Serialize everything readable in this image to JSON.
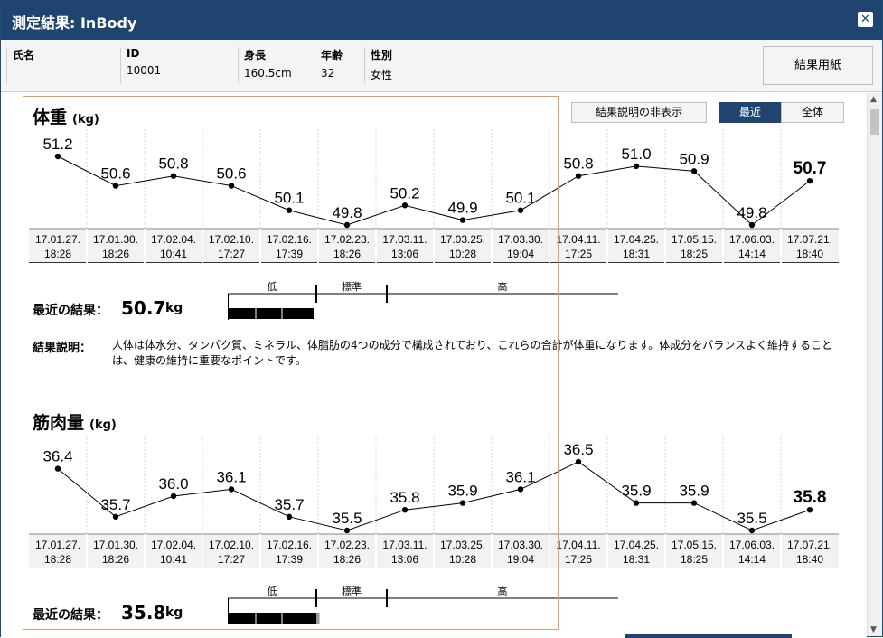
{
  "window": {
    "title": "測定結果: InBody",
    "close_label": "✕"
  },
  "profile": {
    "name": {
      "label": "氏名",
      "value": ""
    },
    "id": {
      "label": "ID",
      "value": "10001"
    },
    "height": {
      "label": "身長",
      "value": "160.5cm"
    },
    "age": {
      "label": "年齢",
      "value": "32"
    },
    "sex": {
      "label": "性別",
      "value": "女性"
    }
  },
  "result_paper_button": "結果用紙",
  "toolbar": {
    "toggle_desc": "結果説明の非表示",
    "range_recent": "最近",
    "range_all": "全体",
    "active_range": "最近"
  },
  "colors": {
    "title_bar": "#1f4470",
    "highlight_border": "#e3a05a",
    "gauge_fill": "#000000",
    "gauge_tail": "#999999"
  },
  "sections": [
    {
      "title": "体重",
      "unit": "(kg)",
      "chart_data": {
        "type": "line",
        "x": [
          "17.01.27.|18:28",
          "17.01.30.|18:26",
          "17.02.04.|10:41",
          "17.02.10.|17:27",
          "17.02.16.|17:39",
          "17.02.23.|18:26",
          "17.03.11.|13:06",
          "17.03.25.|10:28",
          "17.03.30.|19:04",
          "17.04.11.|17:25",
          "17.04.25.|18:31",
          "17.05.15.|18:25",
          "17.06.03.|14:14",
          "17.07.21.|18:40"
        ],
        "values": [
          51.2,
          50.6,
          50.8,
          50.6,
          50.1,
          49.8,
          50.2,
          49.9,
          50.1,
          50.8,
          51.0,
          50.9,
          49.8,
          50.7
        ],
        "labels": [
          "51.2",
          "50.6",
          "50.8",
          "50.6",
          "50.1",
          "49.8",
          "50.2",
          "49.9",
          "50.1",
          "50.8",
          "51.0",
          "50.9",
          "49.8",
          "50.7"
        ],
        "ylim": [
          49.8,
          51.2
        ]
      },
      "gauge": {
        "low": "低",
        "standard": "標準",
        "high": "高",
        "level": 0.22
      },
      "recent": {
        "label": "最近の結果：",
        "value": "50.7",
        "unit": "kg"
      },
      "description": {
        "label": "結果説明：",
        "text": "人体は体水分、タンパク質、ミネラル、体脂肪の4つの成分で構成されており、これらの合計が体重になります。体成分をバランスよく維持することは、健康の維持に重要なポイントです。"
      }
    },
    {
      "title": "筋肉量",
      "unit": "(kg)",
      "chart_data": {
        "type": "line",
        "x": [
          "17.01.27.|18:28",
          "17.01.30.|18:26",
          "17.02.04.|10:41",
          "17.02.10.|17:27",
          "17.02.16.|17:39",
          "17.02.23.|18:26",
          "17.03.11.|13:06",
          "17.03.25.|10:28",
          "17.03.30.|19:04",
          "17.04.11.|17:25",
          "17.04.25.|18:31",
          "17.05.15.|18:25",
          "17.06.03.|14:14",
          "17.07.21.|18:40"
        ],
        "values": [
          36.4,
          35.7,
          36.0,
          36.1,
          35.7,
          35.5,
          35.8,
          35.9,
          36.1,
          36.5,
          35.9,
          35.9,
          35.5,
          35.8
        ],
        "labels": [
          "36.4",
          "35.7",
          "36.0",
          "36.1",
          "35.7",
          "35.5",
          "35.8",
          "35.9",
          "36.1",
          "36.5",
          "35.9",
          "35.9",
          "35.5",
          "35.8"
        ],
        "ylim": [
          35.5,
          36.5
        ]
      },
      "gauge": {
        "low": "低",
        "standard": "標準",
        "high": "高",
        "level": 0.235
      },
      "recent": {
        "label": "最近の結果：",
        "value": "35.8",
        "unit": "kg"
      }
    }
  ]
}
